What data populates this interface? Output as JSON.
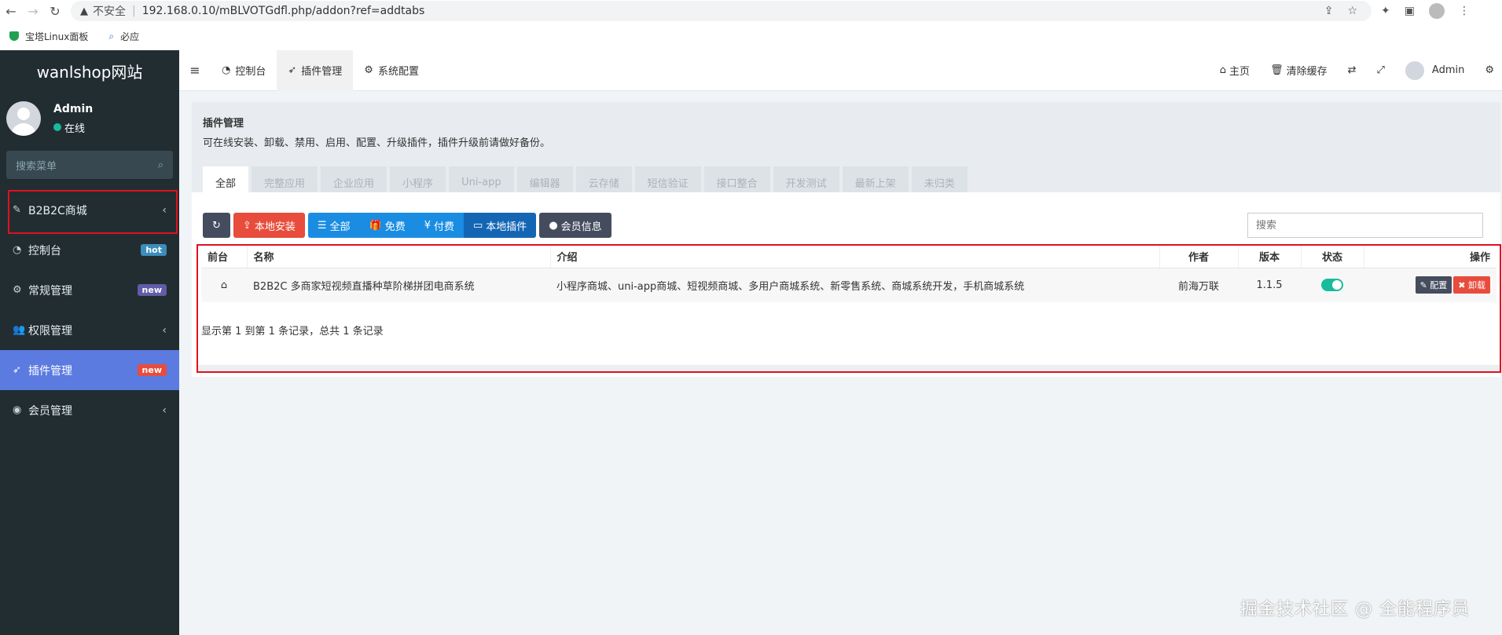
{
  "browser": {
    "insecure_label": "不安全",
    "url": "192.168.0.10/mBLVOTGdfl.php/addon?ref=addtabs",
    "bookmarks": [
      {
        "label": "宝塔Linux面板"
      },
      {
        "label": "必应"
      }
    ]
  },
  "sidebar": {
    "logo": "wanlshop网站",
    "user": {
      "name": "Admin",
      "status": "在线"
    },
    "search_placeholder": "搜索菜单",
    "items": [
      {
        "label": "B2B2C商城",
        "icon": "magic-wand-icon"
      },
      {
        "label": "控制台",
        "badge": "hot",
        "badge_color": "#3c8dbc"
      },
      {
        "label": "常规管理",
        "badge": "new",
        "badge_color": "#605ca8"
      },
      {
        "label": "权限管理"
      },
      {
        "label": "插件管理",
        "badge": "new",
        "badge_color": "#e74c3c"
      },
      {
        "label": "会员管理"
      }
    ]
  },
  "topnav": {
    "tabs": [
      {
        "label": "控制台"
      },
      {
        "label": "插件管理"
      },
      {
        "label": "系统配置"
      }
    ],
    "home": "主页",
    "clear_cache": "清除缓存",
    "admin": "Admin"
  },
  "panel": {
    "title": "插件管理",
    "description": "可在线安装、卸载、禁用、启用、配置、升级插件，插件升级前请做好备份。",
    "tabs": [
      "全部",
      "完整应用",
      "企业应用",
      "小程序",
      "Uni-app",
      "编辑器",
      "云存储",
      "短信验证",
      "接口整合",
      "开发测试",
      "最新上架",
      "未归类"
    ]
  },
  "toolbar": {
    "local_install": "本地安装",
    "filter_all": "全部",
    "filter_free": "免费",
    "filter_paid": "付费",
    "filter_local": "本地插件",
    "member_info": "会员信息",
    "search_placeholder": "搜索"
  },
  "table": {
    "headers": [
      "前台",
      "名称",
      "介绍",
      "作者",
      "版本",
      "状态",
      "操作"
    ],
    "rows": [
      {
        "name": "B2B2C 多商家短视频直播种草阶梯拼团电商系统",
        "intro": "小程序商城、uni-app商城、短视频商城、多用户商城系统、新零售系统、商城系统开发，手机商城系统",
        "author": "前海万联",
        "version": "1.1.5",
        "status_on": true,
        "config_label": "配置",
        "uninstall_label": "卸载"
      }
    ],
    "summary": "显示第 1 到第 1 条记录，总共 1 条记录"
  },
  "watermark": "掘金技术社区 @ 全能程序员"
}
